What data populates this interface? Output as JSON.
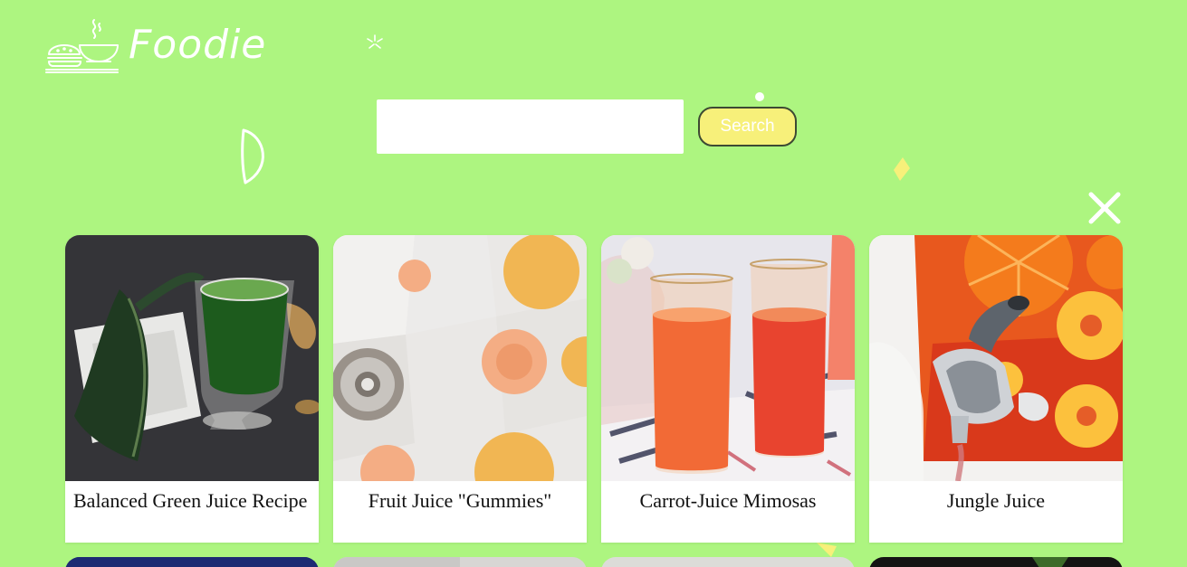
{
  "brand": {
    "name": "Foodie",
    "logo_icon": "food-bowl-sandwich-icon"
  },
  "search": {
    "placeholder": "",
    "value": "",
    "button_label": "Search"
  },
  "close_icon": "close-icon",
  "recipes": [
    {
      "title": "Balanced Green Juice Recipe",
      "image": "green-juice-photo"
    },
    {
      "title": "Fruit Juice \"Gummies\"",
      "image": "gummies-photo"
    },
    {
      "title": "Carrot-Juice Mimosas",
      "image": "carrot-mimosa-photo"
    },
    {
      "title": "Jungle Juice",
      "image": "jungle-juice-photo"
    }
  ],
  "colors": {
    "background": "#adf580",
    "button_bg": "#f7f07a",
    "card_bg": "#ffffff"
  }
}
